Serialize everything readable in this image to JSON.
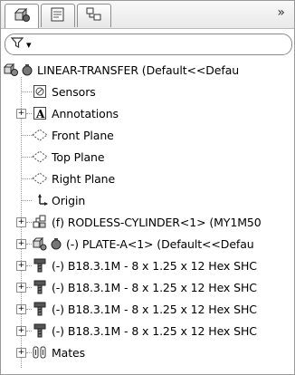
{
  "tabs": [
    {
      "name": "feature-manager-tab",
      "icon": "feature-tree-icon"
    },
    {
      "name": "property-manager-tab",
      "icon": "property-manager-icon"
    },
    {
      "name": "configuration-manager-tab",
      "icon": "configuration-manager-icon"
    }
  ],
  "tab_overflow": "»",
  "filter": {
    "icon": "filter-icon",
    "caret": "▾"
  },
  "tree": {
    "root": {
      "label": "LINEAR-TRANSFER  (Default<<Defau",
      "icon": "assembly-icon"
    },
    "items": [
      {
        "label": "Sensors",
        "icon": "sensors-icon",
        "expandable": false
      },
      {
        "label": "Annotations",
        "icon": "annotations-icon",
        "expandable": true
      },
      {
        "label": "Front Plane",
        "icon": "plane-icon",
        "expandable": false
      },
      {
        "label": "Top Plane",
        "icon": "plane-icon",
        "expandable": false
      },
      {
        "label": "Right Plane",
        "icon": "plane-icon",
        "expandable": false
      },
      {
        "label": "Origin",
        "icon": "origin-icon",
        "expandable": false
      },
      {
        "label": "(f) RODLESS-CYLINDER<1> (MY1M50",
        "icon": "subassembly-icon",
        "expandable": true
      },
      {
        "label": "(-) PLATE-A<1> (Default<<Defau",
        "icon": "part-icon",
        "expandable": true
      },
      {
        "label": "(-) B18.3.1M - 8 x 1.25 x 12 Hex SHC",
        "icon": "screw-icon",
        "expandable": true
      },
      {
        "label": "(-) B18.3.1M - 8 x 1.25 x 12 Hex SHC",
        "icon": "screw-icon",
        "expandable": true
      },
      {
        "label": "(-) B18.3.1M - 8 x 1.25 x 12 Hex SHC",
        "icon": "screw-icon",
        "expandable": true
      },
      {
        "label": "(-) B18.3.1M - 8 x 1.25 x 12 Hex SHC",
        "icon": "screw-icon",
        "expandable": true
      },
      {
        "label": "Mates",
        "icon": "mates-icon",
        "expandable": true
      }
    ]
  }
}
